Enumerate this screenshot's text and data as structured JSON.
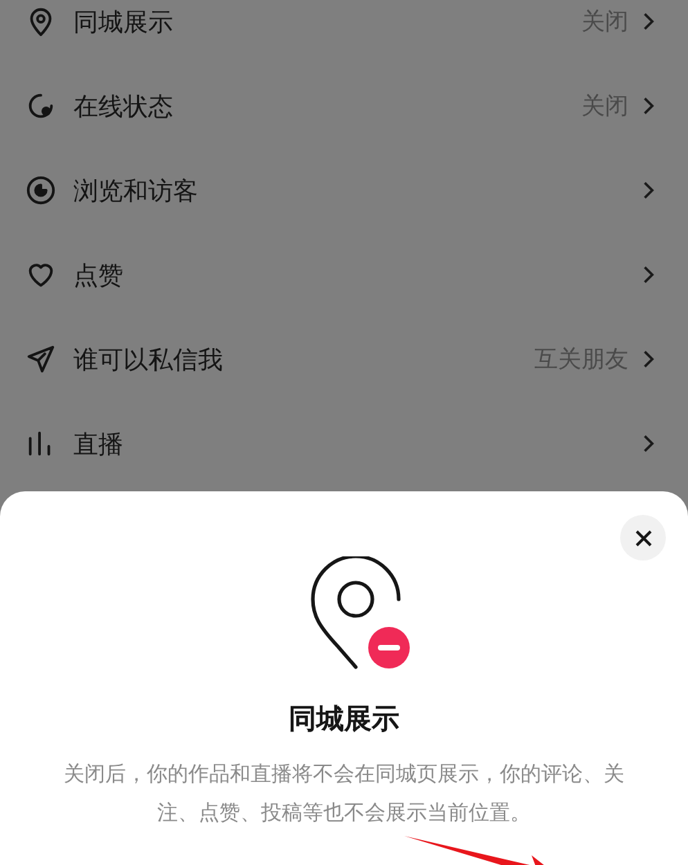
{
  "settings": [
    {
      "label": "同城展示",
      "value": "关闭"
    },
    {
      "label": "在线状态",
      "value": "关闭"
    },
    {
      "label": "浏览和访客"
    },
    {
      "label": "点赞"
    },
    {
      "label": "谁可以私信我",
      "value": "互关朋友"
    },
    {
      "label": "直播"
    }
  ],
  "sheet": {
    "title": "同城展示",
    "description": "关闭后，你的作品和直播将不会在同城页展示，你的评论、关注、点赞、投稿等也不会展示当前位置。"
  }
}
